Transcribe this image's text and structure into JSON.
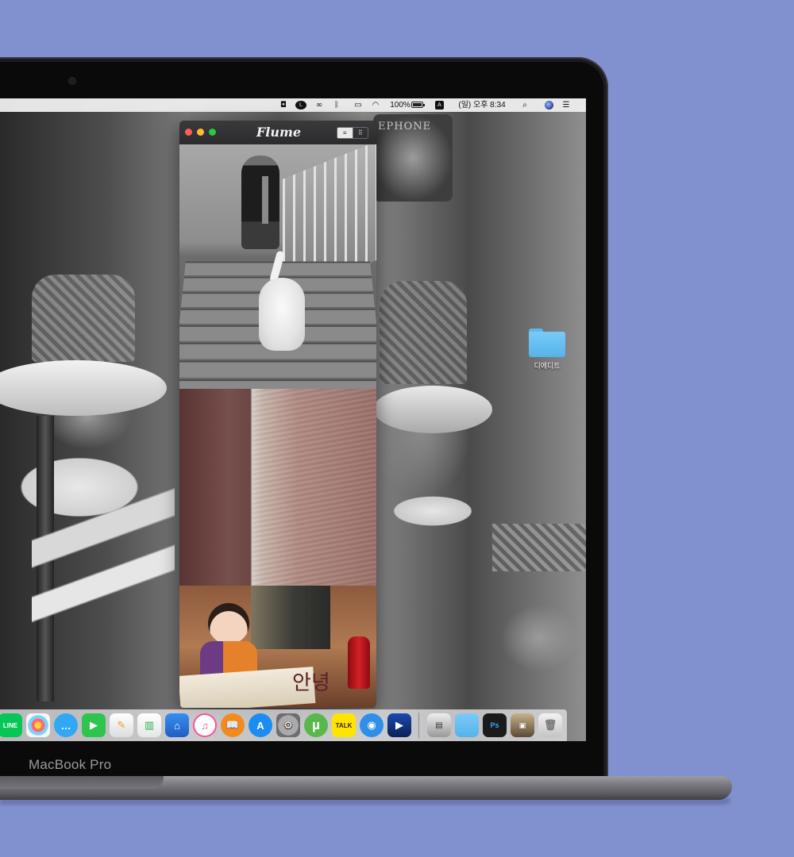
{
  "device": {
    "label": "MacBook Pro"
  },
  "menubar": {
    "status_icons": [
      "camera-icon",
      "line-icon",
      "creative-cloud-icon",
      "bluetooth-icon",
      "airplay-icon",
      "wifi-icon"
    ],
    "battery_percent": "100%",
    "battery_level": 1.0,
    "input_source": "A",
    "clock": "(일) 오후 8:34",
    "right_icons": [
      "spotlight-icon",
      "siri-icon",
      "notification-center-icon"
    ]
  },
  "flume": {
    "title": "Flume",
    "view_modes": [
      "list-view-icon",
      "grid-view-icon"
    ],
    "active_view": "list",
    "photos": [
      {
        "name": "man-and-dog-on-stairs-photo"
      },
      {
        "name": "textured-wall-photo"
      },
      {
        "name": "child-with-paper-photo",
        "visible_text": "안녕"
      }
    ]
  },
  "wallpaper": {
    "shop_sign": "EPHONE"
  },
  "desktop": {
    "folders": [
      {
        "label": "디에디트"
      }
    ]
  },
  "dock": {
    "apps": [
      {
        "name": "line",
        "label": "LINE",
        "color": "#06c755"
      },
      {
        "name": "photos",
        "label": "",
        "color": "#f7f7f7"
      },
      {
        "name": "messages",
        "label": "",
        "color": "#31a8f5"
      },
      {
        "name": "facetime",
        "label": "",
        "color": "#2ec44e"
      },
      {
        "name": "pages",
        "label": "",
        "color": "#f39a24"
      },
      {
        "name": "numbers",
        "label": "",
        "color": "#2fb14b"
      },
      {
        "name": "keynote",
        "label": "",
        "color": "#2a7ee8"
      },
      {
        "name": "itunes",
        "label": "",
        "color": "#ff4f9a"
      },
      {
        "name": "ibooks",
        "label": "",
        "color": "#f28b1e"
      },
      {
        "name": "app-store",
        "label": "",
        "color": "#1d8cf2"
      },
      {
        "name": "system-preferences",
        "label": "",
        "color": "#8e8e93"
      },
      {
        "name": "utorrent",
        "label": "µ",
        "color": "#58b84a"
      },
      {
        "name": "kakaotalk",
        "label": "TALK",
        "color": "#fee500"
      },
      {
        "name": "screenshot",
        "label": "",
        "color": "#2f8fe8"
      },
      {
        "name": "media-player",
        "label": "",
        "color": "#12337c"
      }
    ],
    "stack_items": [
      "downloads-stack",
      "documents-folder",
      "photoshop-stack",
      "image-stack",
      "trash"
    ]
  }
}
